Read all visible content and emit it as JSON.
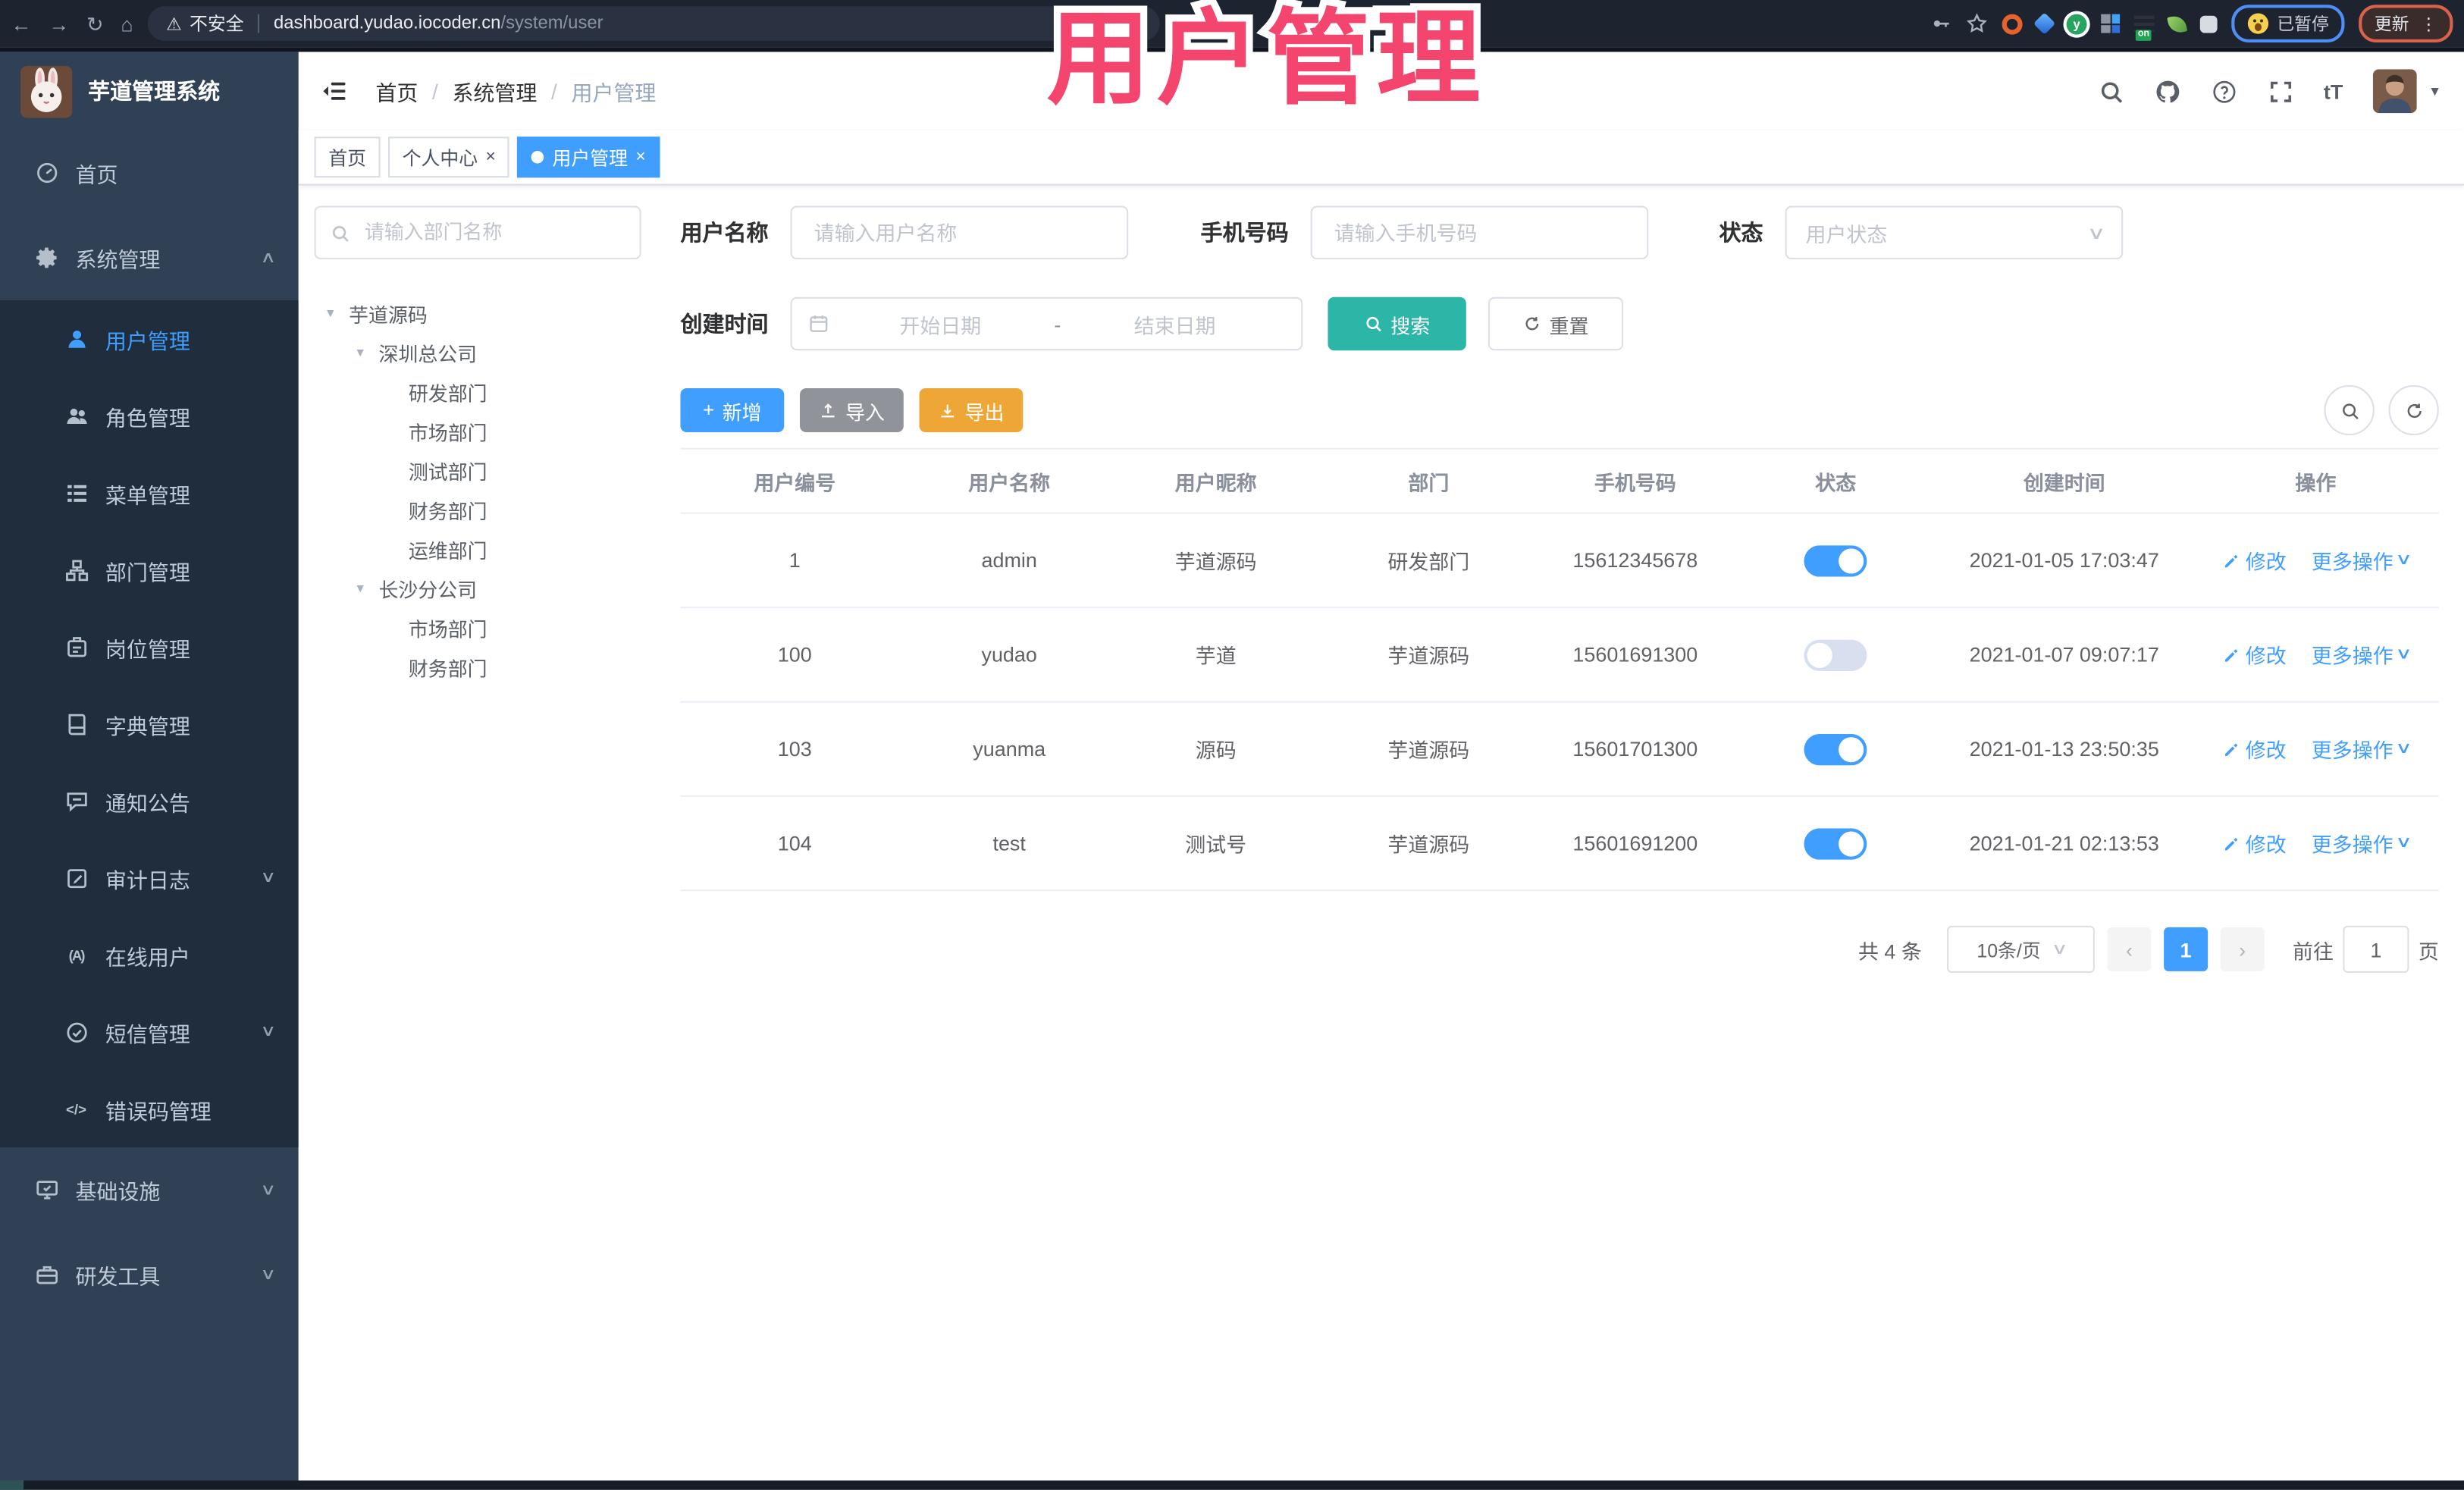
{
  "browser": {
    "security_label": "不安全",
    "url_host": "dashboard.yudao.iocoder.cn",
    "url_path": "/system/user",
    "paused_badge": "已暂停",
    "update_label": "更新"
  },
  "overlay_title": "用户管理",
  "logo": {
    "title": "芋道管理系统"
  },
  "breadcrumb": {
    "items": [
      "首页",
      "系统管理",
      "用户管理"
    ]
  },
  "tabs": [
    {
      "label": "首页",
      "closable": false,
      "active": false
    },
    {
      "label": "个人中心",
      "closable": true,
      "active": false
    },
    {
      "label": "用户管理",
      "closable": true,
      "active": true
    }
  ],
  "sidebar": [
    {
      "label": "首页",
      "icon": "dashboard-icon",
      "level": "top"
    },
    {
      "label": "系统管理",
      "icon": "gear-icon",
      "level": "top",
      "arrow": "up"
    },
    {
      "label": "用户管理",
      "icon": "user-icon",
      "level": "sub",
      "active": true
    },
    {
      "label": "角色管理",
      "icon": "role-icon",
      "level": "sub"
    },
    {
      "label": "菜单管理",
      "icon": "menu-icon",
      "level": "sub"
    },
    {
      "label": "部门管理",
      "icon": "dept-icon",
      "level": "sub"
    },
    {
      "label": "岗位管理",
      "icon": "post-icon",
      "level": "sub"
    },
    {
      "label": "字典管理",
      "icon": "dict-icon",
      "level": "sub"
    },
    {
      "label": "通知公告",
      "icon": "notice-icon",
      "level": "sub"
    },
    {
      "label": "审计日志",
      "icon": "audit-icon",
      "level": "sub",
      "arrow": "down"
    },
    {
      "label": "在线用户",
      "icon": "online-icon",
      "level": "sub"
    },
    {
      "label": "短信管理",
      "icon": "sms-icon",
      "level": "sub",
      "arrow": "down"
    },
    {
      "label": "错误码管理",
      "icon": "errcode-icon",
      "level": "sub"
    },
    {
      "label": "基础设施",
      "icon": "infra-icon",
      "level": "top",
      "arrow": "down"
    },
    {
      "label": "研发工具",
      "icon": "tools-icon",
      "level": "top",
      "arrow": "down"
    }
  ],
  "dept_tree": {
    "search_placeholder": "请输入部门名称",
    "nodes": [
      {
        "label": "芋道源码",
        "depth": 0,
        "expanded": true
      },
      {
        "label": "深圳总公司",
        "depth": 1,
        "expanded": true
      },
      {
        "label": "研发部门",
        "depth": 2
      },
      {
        "label": "市场部门",
        "depth": 2
      },
      {
        "label": "测试部门",
        "depth": 2
      },
      {
        "label": "财务部门",
        "depth": 2
      },
      {
        "label": "运维部门",
        "depth": 2
      },
      {
        "label": "长沙分公司",
        "depth": 1,
        "expanded": true
      },
      {
        "label": "市场部门",
        "depth": 2
      },
      {
        "label": "财务部门",
        "depth": 2
      }
    ]
  },
  "filters": {
    "username": {
      "label": "用户名称",
      "placeholder": "请输入用户名称"
    },
    "mobile": {
      "label": "手机号码",
      "placeholder": "请输入手机号码"
    },
    "status": {
      "label": "状态",
      "placeholder": "用户状态"
    },
    "create_time": {
      "label": "创建时间",
      "start_placeholder": "开始日期",
      "separator": "-",
      "end_placeholder": "结束日期"
    },
    "search_label": "搜索",
    "reset_label": "重置"
  },
  "toolbar": {
    "add_label": "新增",
    "import_label": "导入",
    "export_label": "导出"
  },
  "user_table": {
    "columns": [
      "用户编号",
      "用户名称",
      "用户昵称",
      "部门",
      "手机号码",
      "状态",
      "创建时间",
      "操作"
    ],
    "edit_label": "修改",
    "more_label": "更多操作",
    "rows": [
      {
        "id": "1",
        "username": "admin",
        "nickname": "芋道源码",
        "dept": "研发部门",
        "mobile": "15612345678",
        "status_on": true,
        "create_time": "2021-01-05 17:03:47"
      },
      {
        "id": "100",
        "username": "yudao",
        "nickname": "芋道",
        "dept": "芋道源码",
        "mobile": "15601691300",
        "status_on": false,
        "create_time": "2021-01-07 09:07:17"
      },
      {
        "id": "103",
        "username": "yuanma",
        "nickname": "源码",
        "dept": "芋道源码",
        "mobile": "15601701300",
        "status_on": true,
        "create_time": "2021-01-13 23:50:35"
      },
      {
        "id": "104",
        "username": "test",
        "nickname": "测试号",
        "dept": "芋道源码",
        "mobile": "15601691200",
        "status_on": true,
        "create_time": "2021-01-21 02:13:53"
      }
    ]
  },
  "pagination": {
    "total_text": "共 4 条",
    "page_size": "10条/页",
    "current_page": "1",
    "goto_label": "前往",
    "goto_value": "1",
    "unit_label": "页"
  },
  "colors": {
    "primary": "#409eff",
    "search_teal": "#2cb6a8",
    "export_orange": "#eea636",
    "import_gray": "#909399",
    "sidebar_bg": "#304156",
    "submenu_bg": "#1f2d3d",
    "overlay_pink": "#f3456d"
  }
}
